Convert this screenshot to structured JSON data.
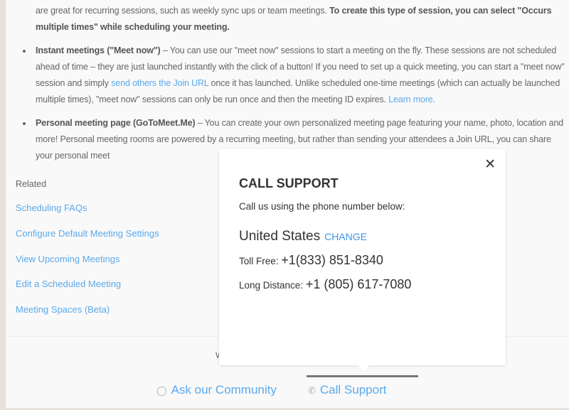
{
  "article": {
    "intro_text": "are great for recurring sessions, such as weekly sync ups or team meetings. ",
    "intro_bold": "To create this type of session, you can select \"Occurs multiple times\" while scheduling your meeting.",
    "bullets": [
      {
        "title": "Instant meetings (\"Meet now\")",
        "t1": " – You can use our \"meet now\" sessions to start a meeting on the fly. These sessions are not scheduled ahead of time – they are just launched instantly with the click of a button! If you need to set up a quick meeting, you can start a \"meet now\" session and simply ",
        "link1": "send others the Join URL",
        "t2": " once it has launched. Unlike scheduled one-time meetings (which can actually be launched multiple times), \"meet now\" sessions can only be run once and then the meeting ID expires. ",
        "link2": "Learn more."
      },
      {
        "title": "Personal meeting page (GoToMeet.Me)",
        "t1": " – You can create your own personalized meeting page featuring your name, photo, location and more! Personal meeting rooms are powered by a recurring meeting, but rather than sending your attendees a Join URL, you can share your personal meet"
      }
    ]
  },
  "related": {
    "heading": "Related",
    "links": [
      "Scheduling FAQs",
      "Configure Default Meeting Settings",
      "View Upcoming Meetings",
      "Edit a Scheduled Meeting",
      "Meeting Spaces (Beta)"
    ]
  },
  "footer": {
    "partial_text": "W",
    "community": "Ask our Community",
    "call": "Call Support",
    "community_icon": "speech-bubble-icon",
    "call_icon": "phone-icon"
  },
  "popup": {
    "close": "✕",
    "title": "CALL SUPPORT",
    "subtitle": "Call us using the phone number below:",
    "country": "United States",
    "change": "CHANGE",
    "toll_label": "Toll Free: ",
    "toll": "+1(833) 851-8340",
    "ld_label": "Long Distance: ",
    "ld": "+1 (805) 617-7080"
  },
  "colors": {
    "link": "#5aa9ec",
    "change": "#3d95e6"
  }
}
